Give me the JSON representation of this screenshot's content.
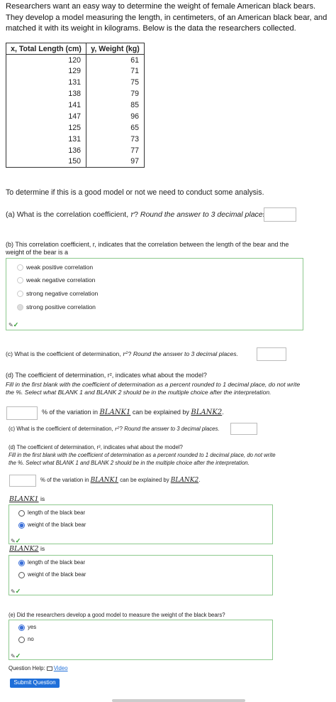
{
  "intro": "Researchers want an easy way to determine the weight of female American black bears. They develop a model measuring the length, in centimeters, of an American black bear, and matched it with its weight in kilograms. Below is the data the researchers collected.",
  "table": {
    "headers": [
      "x, Total Length (cm)",
      "y, Weight (kg)"
    ],
    "rows": [
      [
        "120",
        "61"
      ],
      [
        "129",
        "71"
      ],
      [
        "131",
        "75"
      ],
      [
        "138",
        "79"
      ],
      [
        "141",
        "85"
      ],
      [
        "147",
        "96"
      ],
      [
        "125",
        "65"
      ],
      [
        "131",
        "73"
      ],
      [
        "136",
        "77"
      ],
      [
        "150",
        "97"
      ]
    ]
  },
  "analysis_text": "To determine if this is a good model or not we need to conduct some analysis.",
  "qa": {
    "text": "(a) What is the correlation coefficient, ",
    "var": "r",
    "suffix": "?",
    "instruction": "Round the answer to 3 decimal places.",
    "value": ""
  },
  "qb": {
    "text": "(b) This correlation coefficient, r, indicates that the correlation between the length of the bear and the weight of the bear is a",
    "options": [
      "weak positive correlation",
      "weak negative correlation",
      "strong negative correlation",
      "strong positive correlation"
    ],
    "selected": 3
  },
  "qc": {
    "text": "(c) What is the coefficient of determination, ",
    "var": "r²",
    "suffix": "?",
    "instruction": "Round the answer to 3 decimal places.",
    "value": ""
  },
  "qd": {
    "text": "(d) The coefficient of determination, r², indicates what about the model?",
    "instruction": "Fill in the first blank with the coefficient of determination as a percent rounded to 1 decimal place, do not write the %. Select what BLANK 1 and BLANK 2 should be in the multiple choice after the interpretation.",
    "sentence_pre": "% of the variation in ",
    "blank1": "BLANK1",
    "sentence_mid": " can be explained by ",
    "blank2": "BLANK2",
    "sentence_end": ".",
    "value": ""
  },
  "qc2": {
    "text": "(c) What is the coefficient of determination, ",
    "var": "r²",
    "suffix": "?",
    "instruction": "Round the answer to 3 decimal places.",
    "value": ""
  },
  "qd2": {
    "text": "(d) The coefficient of determination, r², indicates what about the model?",
    "instruction": "Fill in the first blank with the coefficient of determination as a percent rounded to 1 decimal place, do not write the %. Select what BLANK 1 and BLANK 2 should be in the multiple choice after the interpretation.",
    "sentence_pre": "% of the variation in ",
    "blank1": "BLANK1",
    "sentence_mid": " can be explained by ",
    "blank2": "BLANK2",
    "sentence_end": ".",
    "value": ""
  },
  "blank1": {
    "label": "BLANK1",
    "is": " is",
    "options": [
      "length of the black bear",
      "weight of the black bear"
    ],
    "selected": 1
  },
  "blank2": {
    "label": "BLANK2",
    "is": " is",
    "options": [
      "length of the black bear",
      "weight of the black bear"
    ],
    "selected": 0
  },
  "qe": {
    "text": "(e) Did the researchers develop a good model to measure the weight of the black bears?",
    "options": [
      "yes",
      "no"
    ],
    "selected": 0
  },
  "help": {
    "label": "Question Help:",
    "video": "Video"
  },
  "submit": "Submit Question",
  "icons": {
    "pen": "pen-icon",
    "check": "check-icon"
  },
  "colors": {
    "accent": "#1f6fd9",
    "success": "#2d9d2d",
    "correct_border": "#8dc98d"
  }
}
